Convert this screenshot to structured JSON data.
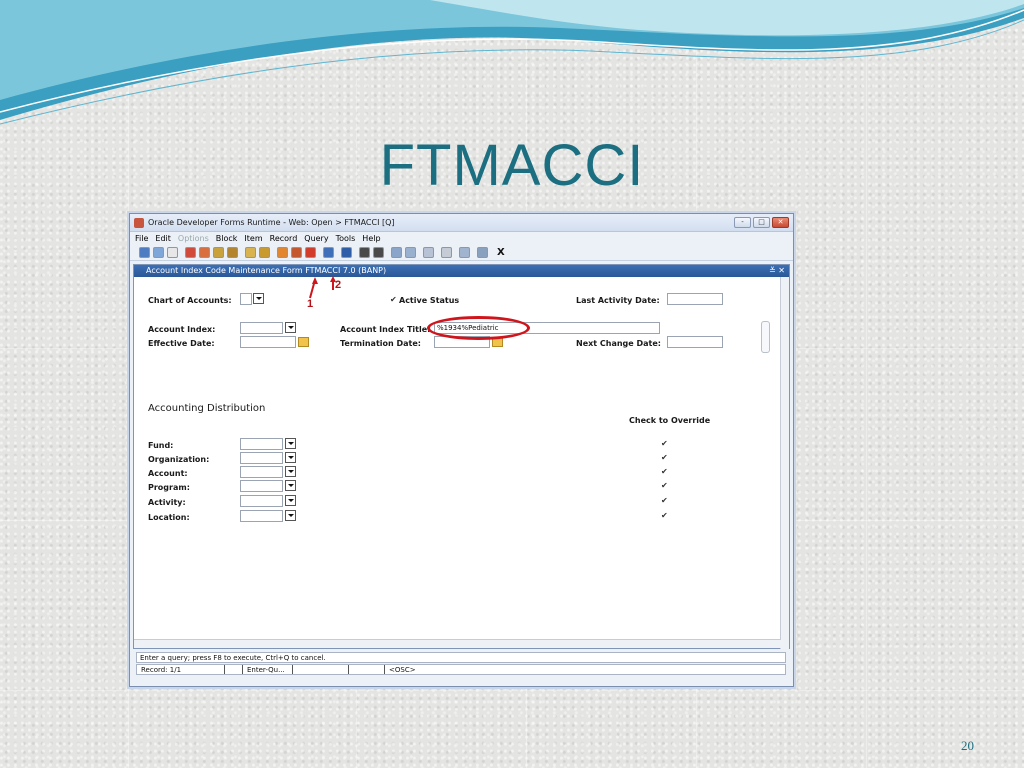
{
  "slide": {
    "title": "FTMACCI",
    "page_number": "20"
  },
  "window": {
    "title": "Oracle Developer Forms Runtime - Web:  Open > FTMACCI [Q]",
    "controls": [
      "-",
      "□",
      "✕"
    ]
  },
  "menu": [
    "File",
    "Edit",
    "Options",
    "Block",
    "Item",
    "Record",
    "Query",
    "Tools",
    "Help"
  ],
  "toolbar": {
    "exit_glyph": "X"
  },
  "form": {
    "title": "Account Index Code Maintenance Form  FTMACCI  7.0  (BANP)",
    "title_controls": "≚ ✕",
    "chart_of_accounts_label": "Chart of Accounts:",
    "active_status_label": "Active Status",
    "last_activity_label": "Last Activity Date:",
    "account_index_label": "Account Index:",
    "account_index_title_label": "Account Index Title:",
    "account_index_title_value": "%1934%Pediatric",
    "effective_date_label": "Effective Date:",
    "termination_date_label": "Termination Date:",
    "next_change_label": "Next Change Date:",
    "distribution_header": "Accounting Distribution",
    "override_header": "Check to Override",
    "fund_label": "Fund:",
    "organization_label": "Organization:",
    "account_label": "Account:",
    "program_label": "Program:",
    "activity_label": "Activity:",
    "location_label": "Location:",
    "checkmark": "✔"
  },
  "status": {
    "message": "Enter a query;  press F8 to execute, Ctrl+Q to cancel.",
    "record": "Record: 1/1",
    "mode": "Enter-Qu...",
    "osc": "<OSC>"
  },
  "annotations": {
    "one": "1",
    "two": "2"
  },
  "colors": {
    "title": "#1b6f80",
    "annotation": "#d0141c",
    "form_bar": "#2a5796"
  }
}
